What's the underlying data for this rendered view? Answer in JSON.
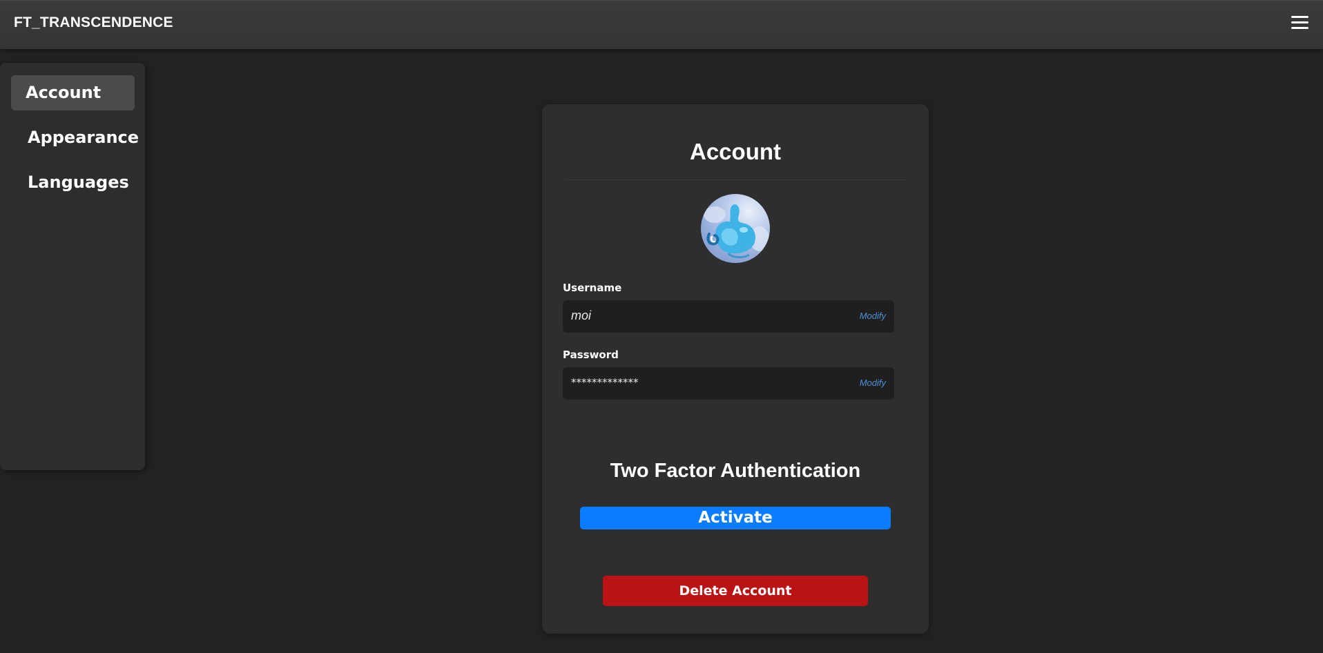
{
  "topbar": {
    "brand": "FT_TRANSCENDENCE",
    "menu_icon": "hamburger-menu-icon"
  },
  "sidebar": {
    "items": [
      {
        "label": "Account",
        "active": true
      },
      {
        "label": "Appearance",
        "active": false
      },
      {
        "label": "Languages",
        "active": false
      }
    ]
  },
  "account": {
    "title": "Account",
    "avatar_icon": "user-avatar-image",
    "username": {
      "label": "Username",
      "value": "moi",
      "modify_label": "Modify"
    },
    "password": {
      "label": "Password",
      "value": "*************",
      "modify_label": "Modify"
    },
    "two_factor": {
      "title": "Two Factor Authentication",
      "activate_label": "Activate"
    },
    "delete_label": "Delete Account"
  },
  "colors": {
    "background": "#222222",
    "topbar": "#383838",
    "card": "#2e2e2e",
    "field": "#1f1f1f",
    "accent_blue": "#0a7cff",
    "link_blue": "#4a90d9",
    "danger_red": "#bb1313"
  }
}
